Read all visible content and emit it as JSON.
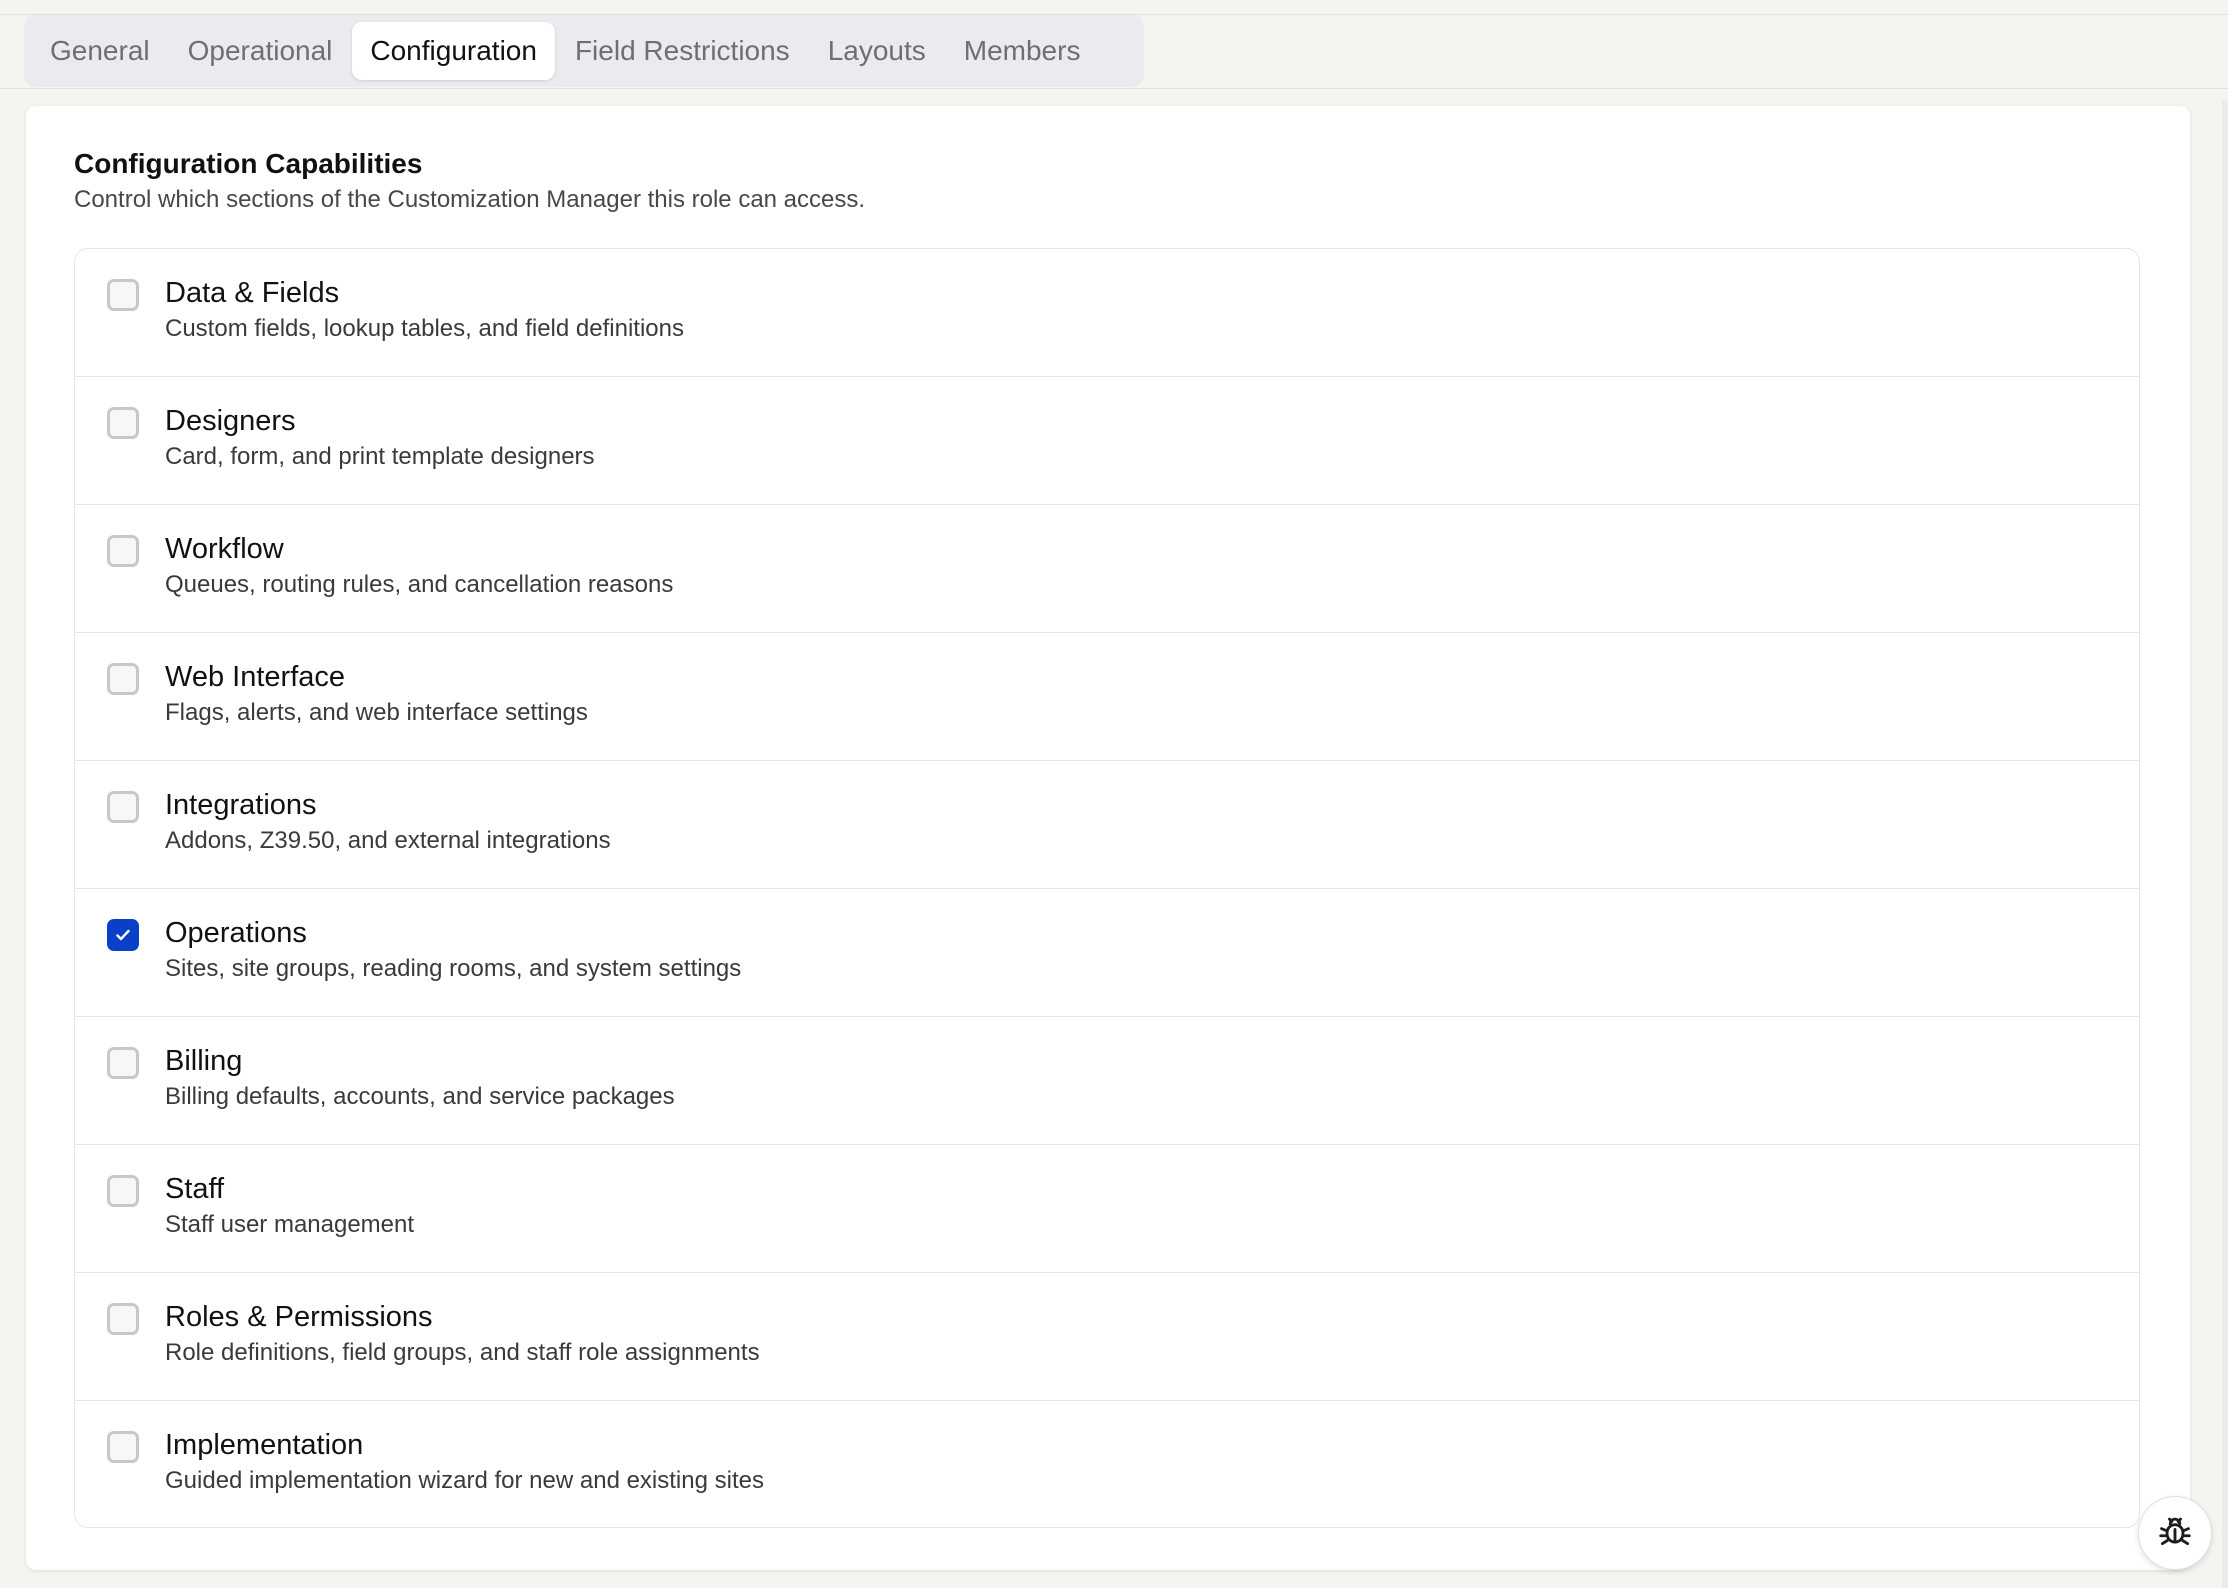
{
  "tabs": [
    {
      "label": "General",
      "active": false
    },
    {
      "label": "Operational",
      "active": false
    },
    {
      "label": "Configuration",
      "active": true
    },
    {
      "label": "Field Restrictions",
      "active": false
    },
    {
      "label": "Layouts",
      "active": false
    },
    {
      "label": "Members",
      "active": false
    }
  ],
  "section": {
    "title": "Configuration Capabilities",
    "subtitle": "Control which sections of the Customization Manager this role can access."
  },
  "capabilities": [
    {
      "name": "data-fields",
      "label": "Data & Fields",
      "description": "Custom fields, lookup tables, and field definitions",
      "checked": false
    },
    {
      "name": "designers",
      "label": "Designers",
      "description": "Card, form, and print template designers",
      "checked": false
    },
    {
      "name": "workflow",
      "label": "Workflow",
      "description": "Queues, routing rules, and cancellation reasons",
      "checked": false
    },
    {
      "name": "web-interface",
      "label": "Web Interface",
      "description": "Flags, alerts, and web interface settings",
      "checked": false
    },
    {
      "name": "integrations",
      "label": "Integrations",
      "description": "Addons, Z39.50, and external integrations",
      "checked": false
    },
    {
      "name": "operations",
      "label": "Operations",
      "description": "Sites, site groups, reading rooms, and system settings",
      "checked": true
    },
    {
      "name": "billing",
      "label": "Billing",
      "description": "Billing defaults, accounts, and service packages",
      "checked": false
    },
    {
      "name": "staff",
      "label": "Staff",
      "description": "Staff user management",
      "checked": false
    },
    {
      "name": "roles-permissions",
      "label": "Roles & Permissions",
      "description": "Role definitions, field groups, and staff role assignments",
      "checked": false
    },
    {
      "name": "implementation",
      "label": "Implementation",
      "description": "Guided implementation wizard for new and existing sites",
      "checked": false
    }
  ],
  "colors": {
    "accent": "#0a3fc7",
    "checkbox_border": "#c8c8cc",
    "tab_track": "#e9ebef"
  },
  "icons": {
    "checkbox_checked": "check-icon",
    "debug": "bug-icon"
  }
}
